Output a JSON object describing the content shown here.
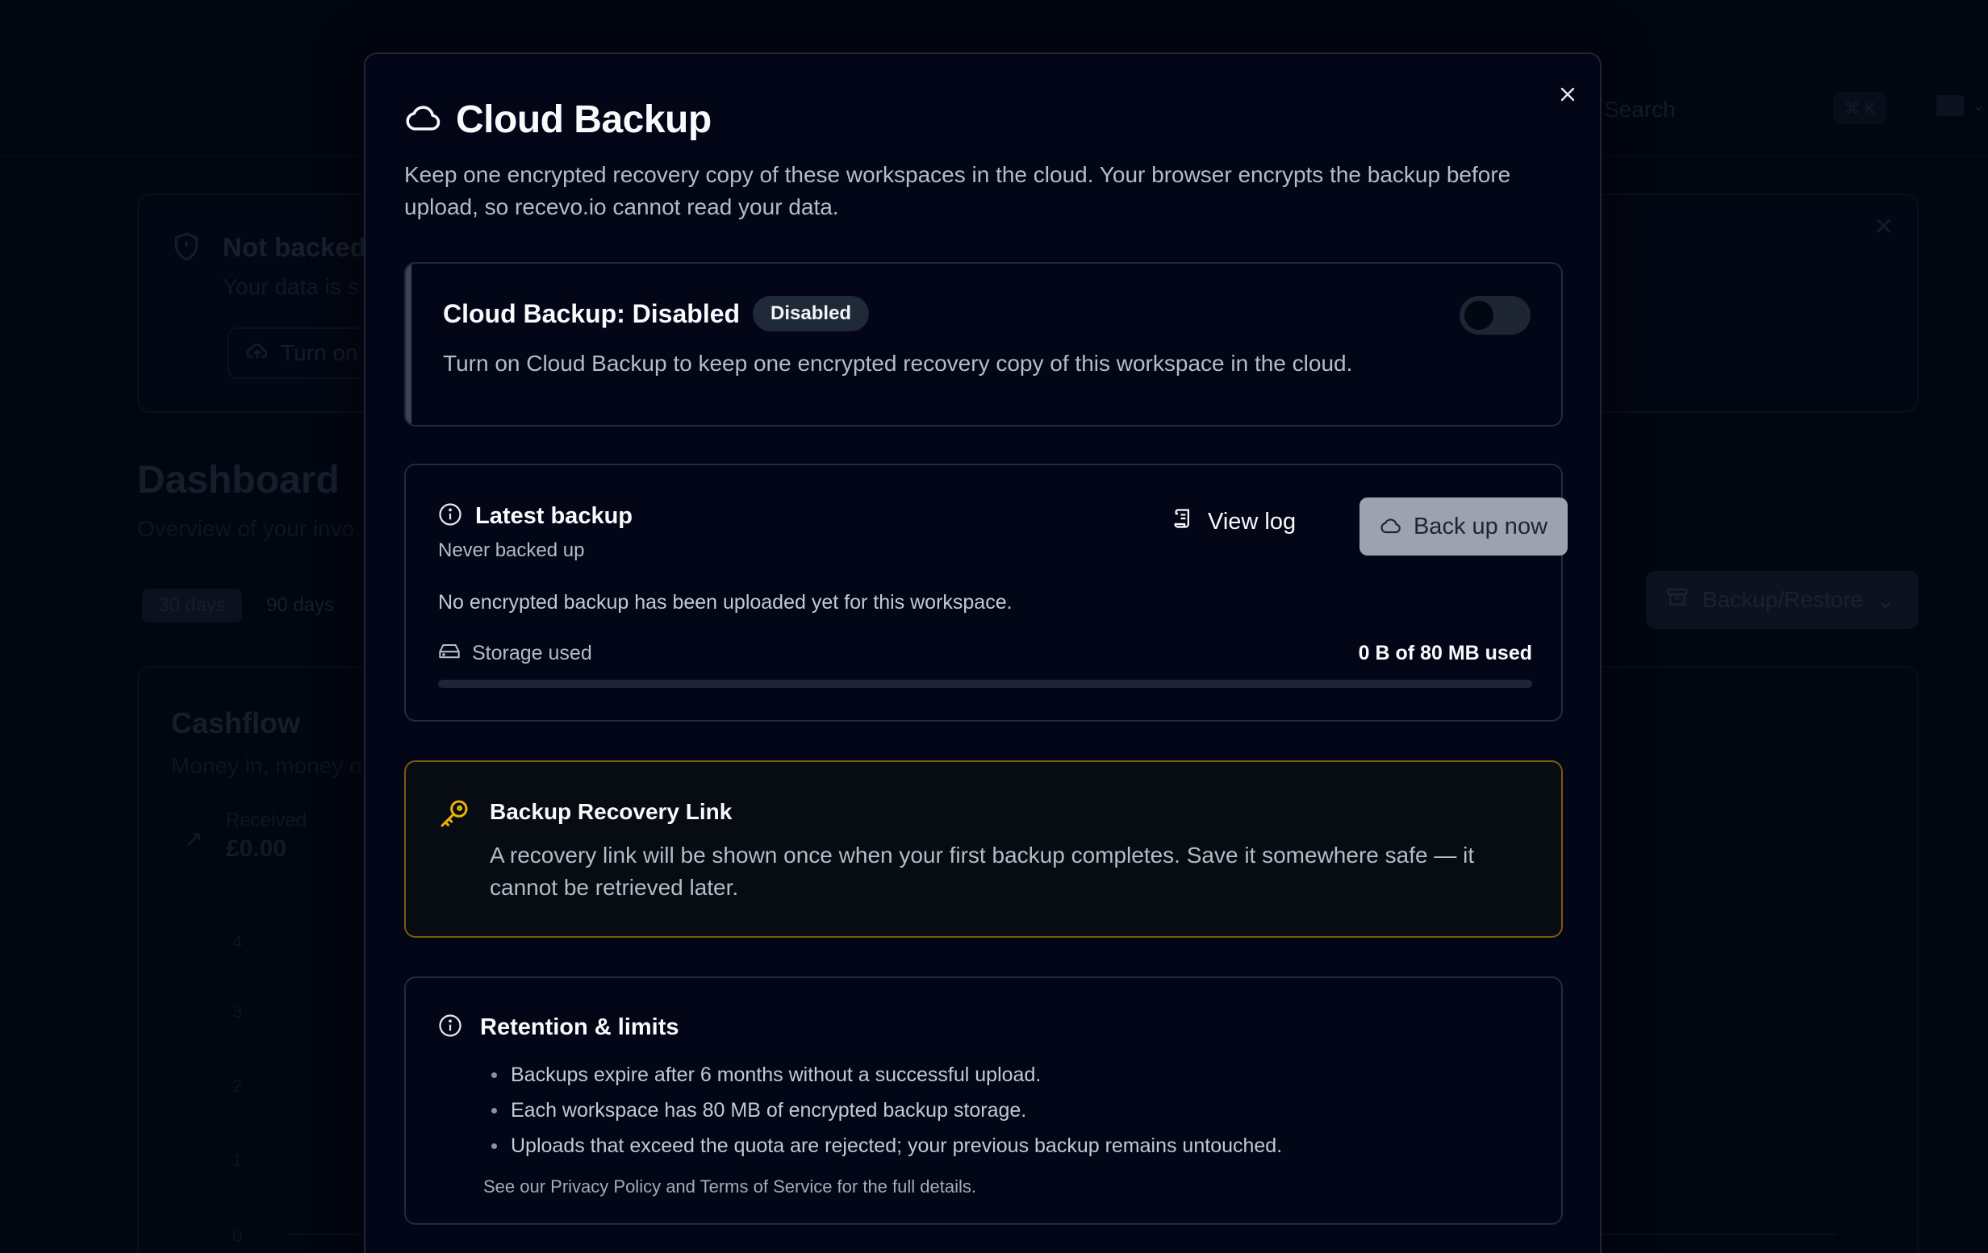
{
  "background": {
    "search_placeholder": "Search",
    "search_shortcut": "⌘ K",
    "banner": {
      "title": "Not backed",
      "subtitle": "Your data is s",
      "button_label": "Turn on"
    },
    "dashboard": {
      "title": "Dashboard",
      "subtitle": "Overview of your invo",
      "ranges": [
        "30 days",
        "90 days"
      ],
      "backup_restore_label": "Backup/Restore"
    },
    "cashflow": {
      "title": "Cashflow",
      "subtitle": "Money in, money o",
      "received_label": "Received",
      "received_value": "£0.00",
      "axis_ticks": [
        "4",
        "3",
        "2",
        "1",
        "0"
      ]
    }
  },
  "modal": {
    "title": "Cloud Backup",
    "description": "Keep one encrypted recovery copy of these workspaces in the cloud. Your browser encrypts the backup before upload, so recevo.io cannot read your data.",
    "status": {
      "title": "Cloud Backup: Disabled",
      "badge": "Disabled",
      "enabled": false,
      "description": "Turn on Cloud Backup to keep one encrypted recovery copy of this workspace in the cloud."
    },
    "latest": {
      "title": "Latest backup",
      "subtitle": "Never backed up",
      "view_log_label": "View log",
      "back_up_label": "Back up now",
      "description": "No encrypted backup has been uploaded yet for this workspace.",
      "storage_label": "Storage used",
      "storage_used_text": "0 B of 80 MB used",
      "storage_fraction": 0
    },
    "recovery": {
      "title": "Backup Recovery Link",
      "description": "A recovery link will be shown once when your first backup completes. Save it somewhere safe — it cannot be retrieved later."
    },
    "retention": {
      "title": "Retention & limits",
      "items": [
        "Backups expire after 6 months without a successful upload.",
        "Each workspace has 80 MB of encrypted backup storage.",
        "Uploads that exceed the quota are rejected; your previous backup remains untouched."
      ],
      "note": "See our Privacy Policy and Terms of Service for the full details."
    }
  },
  "colors": {
    "background": "#030712",
    "modal_bg": "#020617",
    "recovery_border": "#7a5a12",
    "key_icon": "#eab308",
    "button_bg": "#9ca3af"
  }
}
